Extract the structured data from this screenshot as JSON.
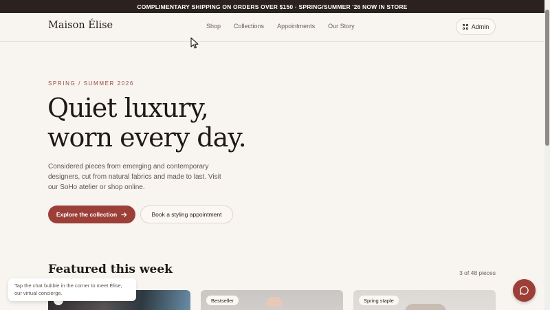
{
  "announcement": "COMPLIMENTARY SHIPPING ON ORDERS OVER $150 · SPRING/SUMMER '26 NOW IN STORE",
  "brand": "Maison Élise",
  "nav": [
    "Shop",
    "Collections",
    "Appointments",
    "Our Story"
  ],
  "admin_label": "Admin",
  "hero": {
    "eyebrow": "SPRING / SUMMER 2026",
    "headline_line1": "Quiet luxury,",
    "headline_line2": "worn every day.",
    "lede": "Considered pieces from emerging and contemporary designers, cut from natural fabrics and made to last. Visit our SoHo atelier or shop online.",
    "primary_cta": "Explore the collection",
    "secondary_cta": "Book a styling appointment"
  },
  "featured": {
    "title": "Featured this week",
    "count": "3 of 48 pieces",
    "cards": [
      {
        "badge": ""
      },
      {
        "badge": "Bestseller"
      },
      {
        "badge": "Spring staple"
      }
    ]
  },
  "chat_tip": "Tap the chat bubble in the corner to meet Élise, our virtual concierge.",
  "icons": {
    "admin": "grid-icon",
    "cta_arrow": "arrow-right-icon",
    "chat": "chat-bubble-icon",
    "pointer": "mouse-pointer-icon"
  },
  "colors": {
    "accent": "#9c3f38",
    "background": "#f8f4ef",
    "announcement_bg": "#2b2220"
  }
}
